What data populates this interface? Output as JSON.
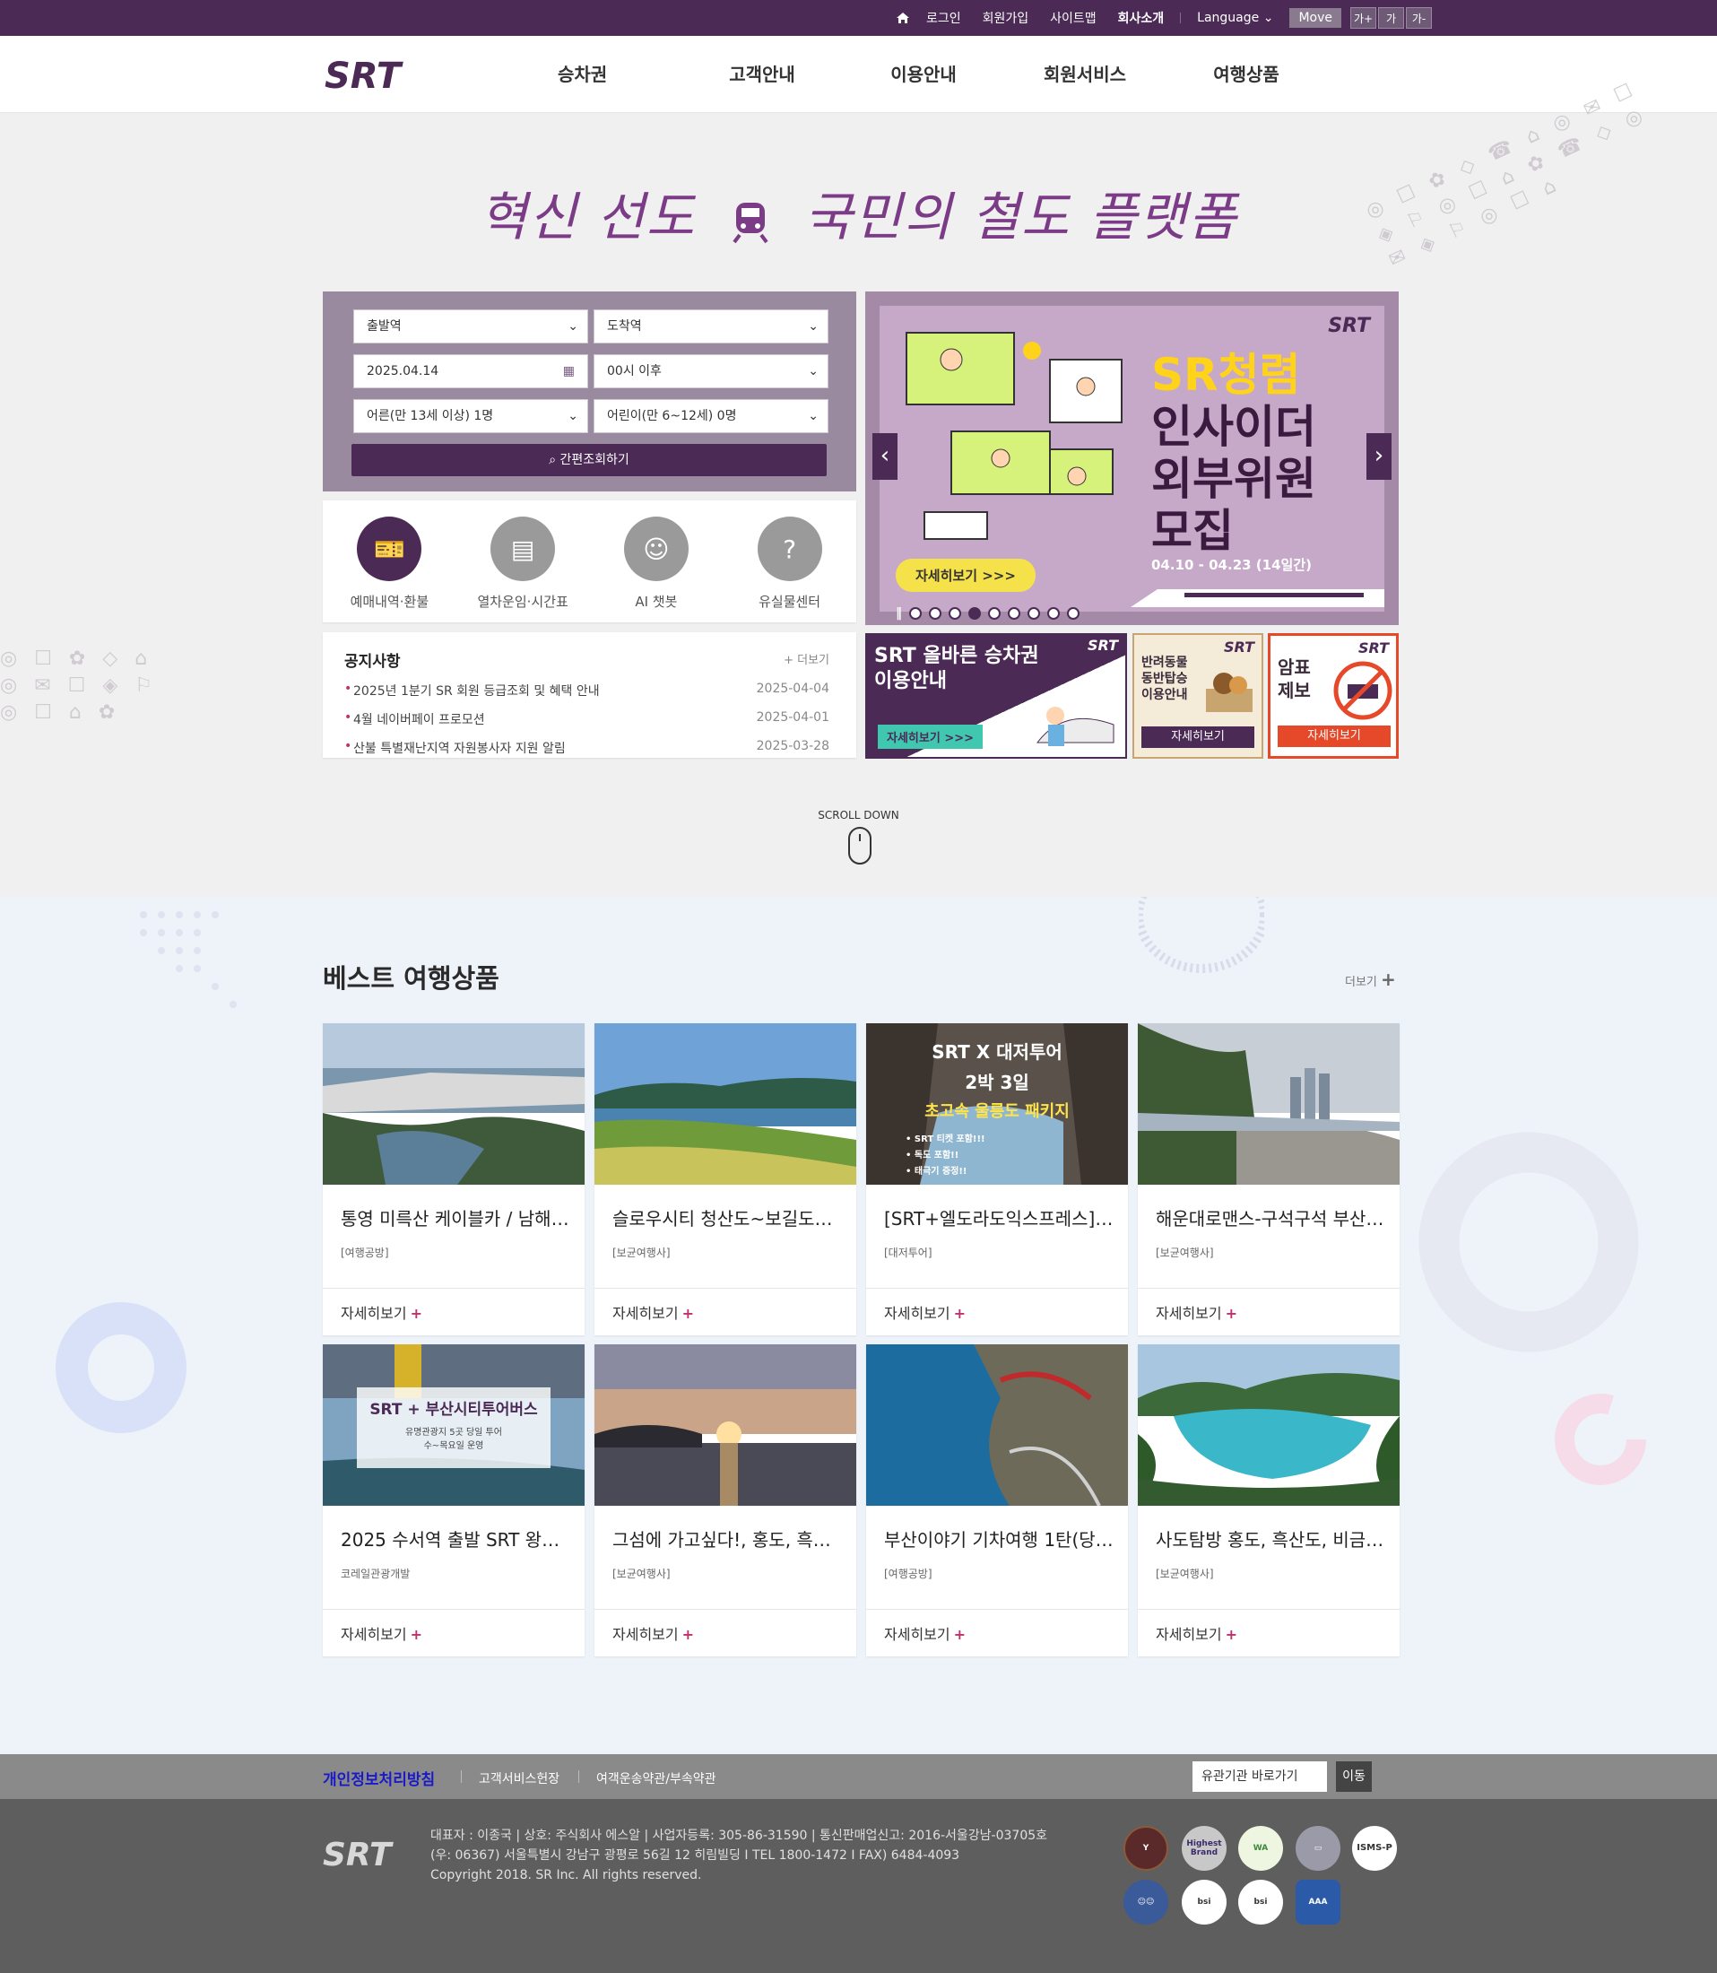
{
  "topbar": {
    "items": [
      "로그인",
      "회원가입",
      "사이트맵",
      "회사소개"
    ],
    "language": "Language",
    "move": "Move",
    "font_sizes": [
      "가+",
      "가",
      "가-"
    ]
  },
  "header": {
    "logo_text": "SRT",
    "menu": [
      "승차권",
      "고객안내",
      "이용안내",
      "회원서비스",
      "여행상품"
    ]
  },
  "hero": {
    "slogan_left": "혁신 선도",
    "slogan_right": "국민의 철도 플랫폼"
  },
  "search": {
    "departure": "출발역",
    "arrival": "도착역",
    "date": "2025.04.14",
    "time": "00시 이후",
    "adult": "어른(만 13세 이상) 1명",
    "child": "어린이(만 6~12세) 0명",
    "button": "간편조회하기"
  },
  "quick_menu": [
    {
      "label": "예매내역·환불",
      "icon": "ticket-icon"
    },
    {
      "label": "열차운임·시간표",
      "icon": "timetable-icon"
    },
    {
      "label": "AI 챗봇",
      "icon": "robot-icon"
    },
    {
      "label": "유실물센터",
      "icon": "lost-found-icon"
    }
  ],
  "notice": {
    "title": "공지사항",
    "more": "+ 더보기",
    "items": [
      {
        "text": "2025년 1분기 SR 회원 등급조회 및 혜택 안내",
        "date": "2025-04-04"
      },
      {
        "text": "4월 네이버페이 프로모션",
        "date": "2025-04-01"
      },
      {
        "text": "산불 특별재난지역 자원봉사자 지원 알림",
        "date": "2025-03-28"
      }
    ]
  },
  "main_banner": {
    "logo": "SRT",
    "title_line1": "SR청렴",
    "title_line2": "인사이더",
    "title_line3": "외부위원",
    "title_line4": "모집",
    "date": "04.10 - 04.23 (14일간)",
    "button": "자세히보기 >>>",
    "total_dots": 9,
    "active_dot": 4
  },
  "sub_banners": [
    {
      "line1": "SRT 올바른 승차권",
      "line2": "이용안내",
      "button": "자세히보기 >>>",
      "logo": "SRT"
    },
    {
      "line1": "반려동물",
      "line2": "동반탑승",
      "line3": "이용안내",
      "button": "자세히보기",
      "logo": "SRT"
    },
    {
      "line1": "암표",
      "line2": "제보",
      "button": "자세히보기",
      "logo": "SRT"
    }
  ],
  "scroll_label": "SCROLL DOWN",
  "best": {
    "title": "베스트 여행상품",
    "more": "더보기",
    "detail": "자세히보기",
    "cards": [
      {
        "title": "통영 미륵산 케이블카 / 남해…",
        "agency": "[여행공방]"
      },
      {
        "title": "슬로우시티 청산도~보길도~…",
        "agency": "[보균여행사]"
      },
      {
        "title": "[SRT+엘도라도익스프레스]…",
        "agency": "[대저투어]",
        "img_text": [
          "SRT X 대저투어",
          "2박 3일",
          "초고속 울릉도 패키지",
          "• SRT 티켓 포함!!!",
          "• 독도 포함!!",
          "• 태극기 증정!!"
        ]
      },
      {
        "title": "해운대로맨스-구석구석 부산…",
        "agency": "[보균여행사]"
      },
      {
        "title": "2025 수서역 출발 SRT 왕복…",
        "agency": "코레일관광개발",
        "img_text": [
          "SRT + 부산시티투어버스",
          "유명관광지 5곳 당일 투어",
          "수~목요일 운영"
        ]
      },
      {
        "title": "그섬에 가고싶다!, 홍도, 흑…",
        "agency": "[보균여행사]"
      },
      {
        "title": "부산이야기 기차여행 1탄(당…",
        "agency": "[여행공방]"
      },
      {
        "title": "사도탐방 홍도, 흑산도, 비금…",
        "agency": "[보균여행사]"
      }
    ]
  },
  "footer_nav": {
    "privacy": "개인정보처리방침",
    "links": [
      "고객서비스헌장",
      "여객운송약관/부속약관"
    ],
    "select": "유관기관 바로가기",
    "go": "이동"
  },
  "footer": {
    "logo": "SRT",
    "line1": "대표자 : 이종국  |  상호: 주식회사 에스알  |  사업자등록: 305-86-31590  |  통신판매업신고: 2016-서울강남-03705호",
    "line2": "(우: 06367) 서울특별시 강남구 광평로 56길 12 히림빌딩 I TEL 1800-1472 I FAX) 6484-4093",
    "line3": "Copyright 2018. SR Inc. All rights reserved.",
    "badges": [
      "Highest Brand",
      "WA",
      "ISMS-P",
      "bsi",
      "bsi",
      "AAA"
    ]
  },
  "colors": {
    "brand": "#4b2a56",
    "accent": "#c0306d",
    "banner": "#c6a8c8"
  }
}
